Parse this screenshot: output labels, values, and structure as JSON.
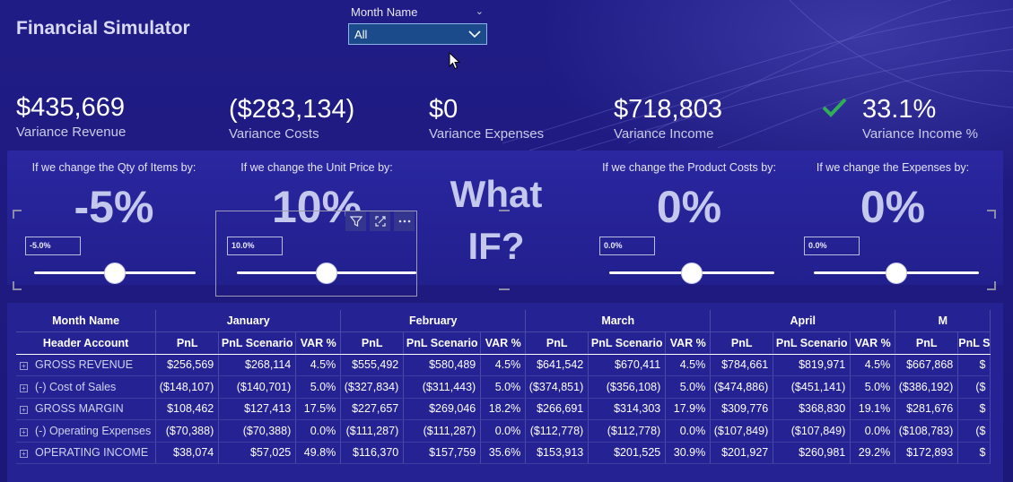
{
  "app": {
    "title": "Financial Simulator"
  },
  "slicer": {
    "label": "Month Name",
    "value": "All"
  },
  "kpis": [
    {
      "value": "$435,669",
      "caption": "Variance Revenue"
    },
    {
      "value": "($283,134)",
      "caption": "Variance Costs"
    },
    {
      "value": "$0",
      "caption": "Variance Expenses"
    },
    {
      "value": "$718,803",
      "caption": "Variance Income"
    },
    {
      "value": "33.1%",
      "caption": "Variance Income %"
    }
  ],
  "controls": [
    {
      "question": "If we change the Qty of Items by:",
      "value": "-5%",
      "input": "-5.0%",
      "level": 0.5
    },
    {
      "question": "If we change the Unit Price by:",
      "value": "10%",
      "input": "10.0%",
      "level": 0.5
    },
    {
      "question": "If we change the Product Costs by:",
      "value": "0%",
      "input": "0.0%",
      "level": 0.5
    },
    {
      "question": "If we change the Expenses by:",
      "value": "0%",
      "input": "0.0%",
      "level": 0.5
    }
  ],
  "whatif": {
    "line1": "What",
    "line2": "IF?"
  },
  "icons": {
    "check": "check-icon",
    "filter": "filter-icon",
    "focus": "focus-mode-icon",
    "more": "more-options-icon",
    "expand": "expand-icon",
    "cursor": "mouse-cursor-icon"
  },
  "colors": {
    "check": "#2fae57",
    "background": "#1d1a7c",
    "slicer_box": "#1b4b8a"
  },
  "table": {
    "row_header": "Month Name",
    "account_header": "Header Account",
    "months": [
      "January",
      "February",
      "March",
      "April",
      "M"
    ],
    "sub_headers": [
      "PnL",
      "PnL Scenario",
      "VAR %"
    ],
    "last_partial_sub": [
      "PnL",
      "PnL S"
    ],
    "rows": [
      {
        "account": "GROSS REVENUE",
        "cells": [
          "$256,569",
          "$268,114",
          "4.5%",
          "$555,492",
          "$580,489",
          "4.5%",
          "$641,542",
          "$670,411",
          "4.5%",
          "$784,661",
          "$819,971",
          "4.5%",
          "$667,868",
          "$"
        ]
      },
      {
        "account": "(-) Cost of Sales",
        "cells": [
          "($148,107)",
          "($140,701)",
          "5.0%",
          "($327,834)",
          "($311,443)",
          "5.0%",
          "($374,851)",
          "($356,108)",
          "5.0%",
          "($474,886)",
          "($451,141)",
          "5.0%",
          "($386,192)",
          "($"
        ]
      },
      {
        "account": "GROSS MARGIN",
        "cells": [
          "$108,462",
          "$127,413",
          "17.5%",
          "$227,657",
          "$269,046",
          "18.2%",
          "$266,691",
          "$314,303",
          "17.9%",
          "$309,776",
          "$368,830",
          "19.1%",
          "$281,676",
          "$"
        ]
      },
      {
        "account": "(-) Operating Expenses",
        "cells": [
          "($70,388)",
          "($70,388)",
          "0.0%",
          "($111,287)",
          "($111,287)",
          "0.0%",
          "($112,778)",
          "($112,778)",
          "0.0%",
          "($107,849)",
          "($107,849)",
          "0.0%",
          "($108,783)",
          "($"
        ]
      },
      {
        "account": "OPERATING INCOME",
        "cells": [
          "$38,074",
          "$57,025",
          "49.8%",
          "$116,370",
          "$157,759",
          "35.6%",
          "$153,913",
          "$201,525",
          "30.9%",
          "$201,927",
          "$260,981",
          "29.2%",
          "$172,893",
          "$"
        ]
      }
    ]
  }
}
